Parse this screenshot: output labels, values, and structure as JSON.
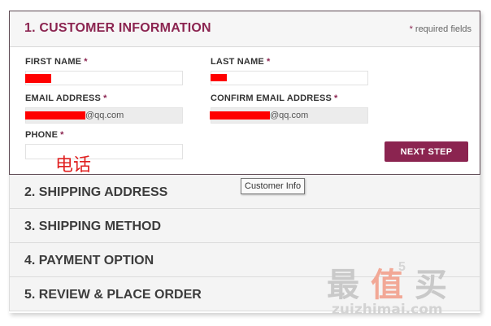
{
  "steps": {
    "active": {
      "title": "1. CUSTOMER INFORMATION",
      "required_note": "required fields",
      "required_star": "*",
      "fields": {
        "first_name": {
          "label": "FIRST NAME",
          "star": "*"
        },
        "last_name": {
          "label": "LAST NAME",
          "star": "*"
        },
        "email": {
          "label": "EMAIL ADDRESS",
          "star": "*",
          "value_suffix": "@qq.com"
        },
        "confirm_email": {
          "label": "CONFIRM EMAIL ADDRESS",
          "star": "*",
          "value_suffix": "@qq.com"
        },
        "phone": {
          "label": "PHONE",
          "star": "*"
        }
      },
      "phone_annotation": "电话",
      "next_button": "NEXT STEP"
    },
    "shipping_address": "2. SHIPPING ADDRESS",
    "shipping_method": "3. SHIPPING METHOD",
    "payment_option": "4. PAYMENT OPTION",
    "review": "5. REVIEW & PLACE ORDER"
  },
  "tooltip": "Customer Info",
  "watermark": {
    "hanzi": [
      "最",
      "值",
      "买"
    ],
    "small": "5",
    "domain": "zuizhimai.com"
  },
  "colors": {
    "accent": "#8b2450",
    "redaction": "#ff0000",
    "annotation": "#e02020"
  }
}
